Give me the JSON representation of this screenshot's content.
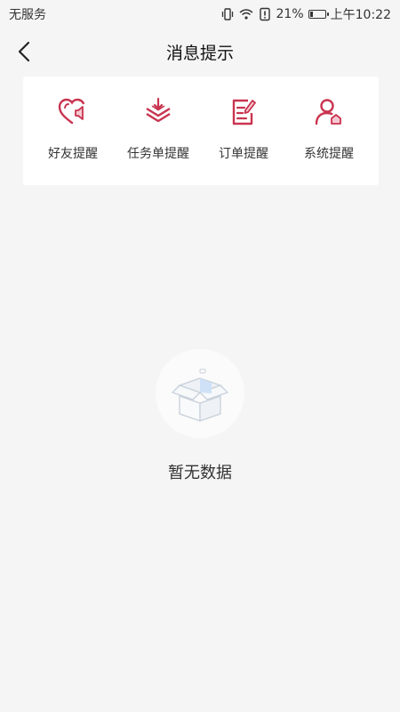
{
  "status_bar": {
    "carrier": "无服务",
    "battery": "21%",
    "battery_level": 0.21,
    "time": "上午10:22"
  },
  "header": {
    "title": "消息提示"
  },
  "quick_links": [
    {
      "label": "好友提醒",
      "icon": "heart-speaker-icon"
    },
    {
      "label": "任务单提醒",
      "icon": "download-tray-icon"
    },
    {
      "label": "订单提醒",
      "icon": "order-edit-icon"
    },
    {
      "label": "系统提醒",
      "icon": "user-system-icon"
    }
  ],
  "empty_state": {
    "text": "暂无数据",
    "icon": "empty-box-icon"
  },
  "colors": {
    "accent": "#c9344f",
    "background": "#f5f5f5",
    "card": "#ffffff"
  }
}
